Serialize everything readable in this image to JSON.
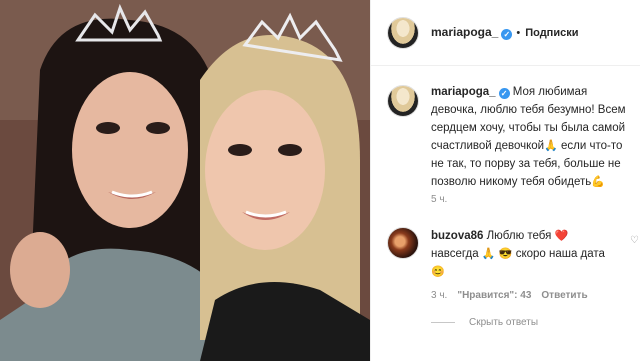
{
  "post": {
    "username": "mariapoga_",
    "follow_state": "Подписки",
    "dot": "•",
    "caption_text": [
      "Моя любимая",
      "девочка, люблю тебя безумно! Всем",
      "сердцем хочу, чтобы ты была самой",
      "счастливой девочкой",
      " если что-то",
      "не так, то порву за тебя, больше не",
      "позволю никому тебя обидеть"
    ],
    "caption_time": "5 ч.",
    "pray_emoji": "🙏",
    "muscle_emoji": "💪"
  },
  "comment": {
    "username": "buzova86",
    "text_1": "Люблю тебя",
    "heart_emoji": "❤️",
    "text_2": "навсегда",
    "text_3": "скоро наша дата",
    "smile_emoji": "😊",
    "cool_emoji": "😎",
    "time": "3 ч.",
    "likes": "\"Нравится\": 43",
    "reply": "Ответить",
    "hide_replies": "Скрыть ответы",
    "like_icon": "heart-outline-icon"
  },
  "colors": {
    "link_gray": "#8e8e8e",
    "verified_blue": "#3897f0",
    "border": "#efefef"
  }
}
